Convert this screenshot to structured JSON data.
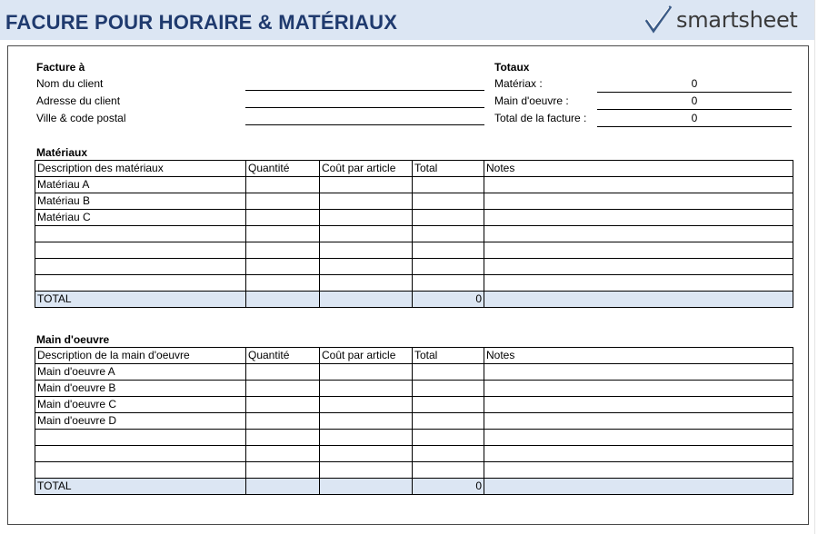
{
  "title": "FACURE POUR HORAIRE & MATÉRIAUX",
  "logo": {
    "text": "smartsheet",
    "icon": "checkmark-icon"
  },
  "invoice_to": {
    "heading": "Facture à",
    "fields": [
      "Nom du client",
      "Adresse du client",
      "Ville & code postal"
    ]
  },
  "totals": {
    "heading": "Totaux",
    "rows": [
      {
        "label": "Matériax :",
        "value": "0"
      },
      {
        "label": "Main d'oeuvre :",
        "value": "0"
      },
      {
        "label": "Total de la facture :",
        "value": "0"
      }
    ]
  },
  "materials": {
    "heading": "Matériaux",
    "columns": [
      "Description des matériaux",
      "Quantité",
      "Coût par article",
      "Total",
      "Notes"
    ],
    "rows": [
      "Matériau A",
      "Matériau B",
      "Matériau C",
      "",
      "",
      "",
      ""
    ],
    "total_label": "TOTAL",
    "total_value": "0"
  },
  "labor": {
    "heading": "Main d'oeuvre",
    "columns": [
      "Description de la main d'oeuvre",
      "Quantité",
      "Coût par article",
      "Total",
      "Notes"
    ],
    "rows": [
      "Main d'oeuvre A",
      "Main d'oeuvre B",
      "Main d'oeuvre C",
      "Main d'oeuvre D",
      "",
      "",
      ""
    ],
    "total_label": "TOTAL",
    "total_value": "0"
  },
  "colors": {
    "banner": "#dce6f3",
    "title": "#1f3a6e",
    "total_row": "#dce6f3"
  }
}
